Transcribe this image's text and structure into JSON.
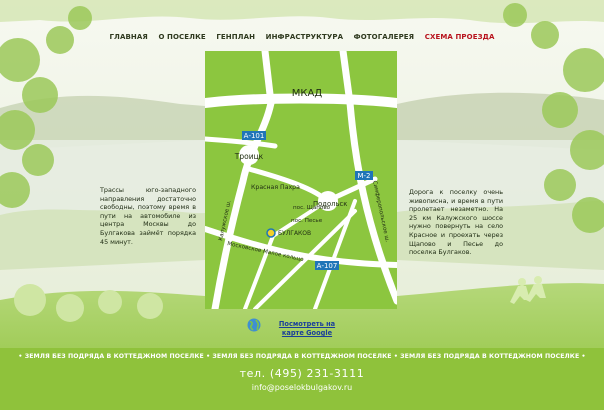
{
  "nav": {
    "items": [
      {
        "label": "ГЛАВНАЯ"
      },
      {
        "label": "О ПОСЕЛКЕ"
      },
      {
        "label": "ГЕНПЛАН"
      },
      {
        "label": "ИНФРАСТРУКТУРА"
      },
      {
        "label": "ФОТОГАЛЕРЕЯ"
      },
      {
        "label": "СХЕМА ПРОЕЗДА"
      }
    ],
    "active_index": 5
  },
  "map": {
    "mkad": "МКАД",
    "a101": "А-101",
    "troitsk": "Троицк",
    "krasnaya_pakhra": "Красная Пахра",
    "kaluzhskoe": "Калужское ш.",
    "podolsk": "Подольск",
    "m2": "М-2",
    "simferopolskoe": "Симферопольское ш.",
    "shchapovo": "пос. Щапово",
    "pesye": "пос. Песье",
    "bulgakov": "БУЛГАКОВ",
    "moskovskoe_maloe_koltso": "Московское Малое кольцо",
    "a107": "А-107"
  },
  "left_text": "Трассы юго-западного направления достаточно свободны, поэтому время в пути на автомобиле из центра Москвы до Булгакова займёт порядка 45 минут.",
  "right_text": "Дорога к поселку очень живописна, и время в пути пролетает незаметно. На 25 км Калужского шоссе нужно повернуть на село Красное и проехать через Щапово и Песье до поселка Булгаков.",
  "map_link": "Посмотреть на карте Google",
  "ticker": "• ЗЕМЛЯ БЕЗ ПОДРЯДА В КОТТЕДЖНОМ ПОСЕЛКЕ • ЗЕМЛЯ БЕЗ ПОДРЯДА В КОТТЕДЖНОМ ПОСЕЛКЕ • ЗЕМЛЯ БЕЗ ПОДРЯДА В КОТТЕДЖНОМ ПОСЕЛКЕ •",
  "phone": "тел. (495) 231-3111",
  "email": "info@poselokbulgakov.ru",
  "colors": {
    "map_green": "#8cc63f",
    "road": "#ffffff",
    "badge_blue": "#1f75b8",
    "active_nav": "#b8141d",
    "footer_green": "#8fc23b"
  }
}
